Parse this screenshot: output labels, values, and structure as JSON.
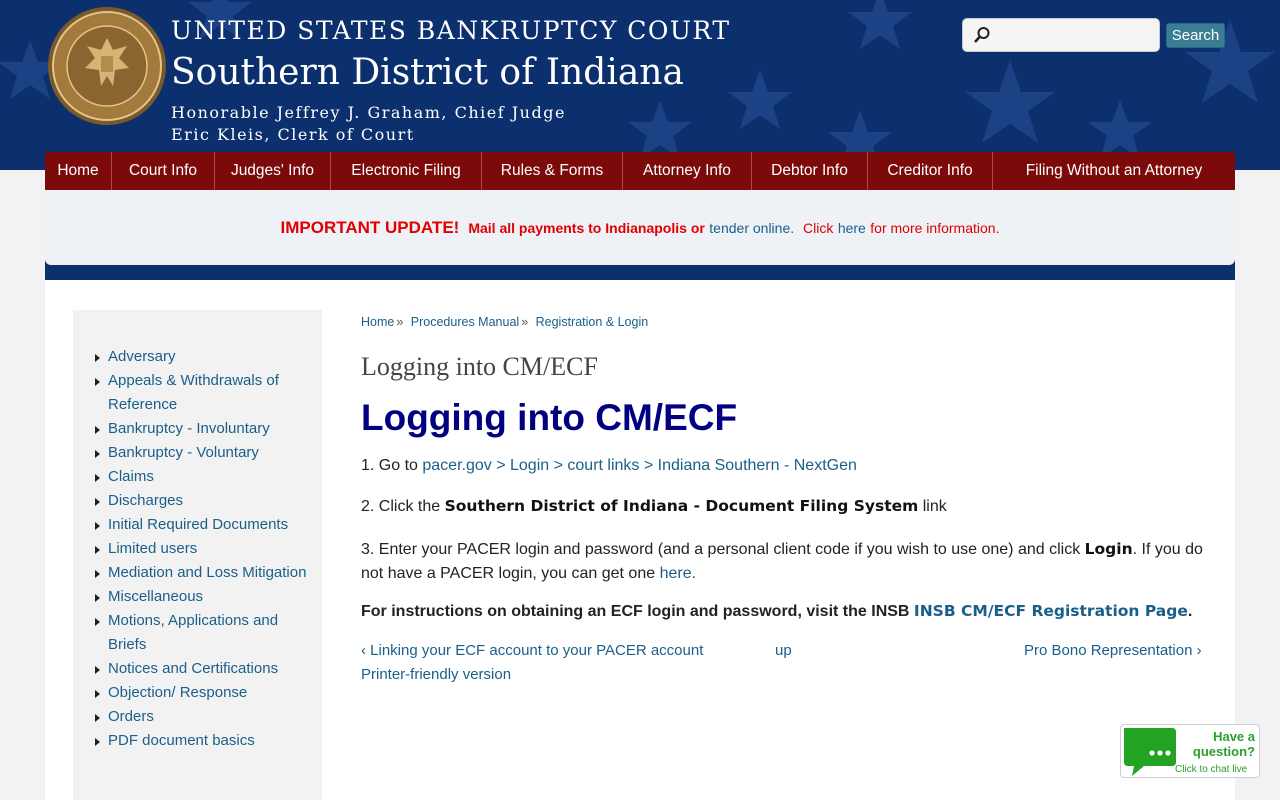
{
  "header": {
    "court_name": "UNITED STATES BANKRUPTCY COURT",
    "district": "Southern District of Indiana",
    "judge": "Honorable Jeffrey J. Graham, Chief Judge",
    "clerk": "Eric Kleis, Clerk of Court",
    "seal_icon": "court-seal-icon",
    "search": {
      "placeholder": "",
      "value": "",
      "button_label": "Search"
    }
  },
  "nav": {
    "items": [
      {
        "label": "Home"
      },
      {
        "label": "Court Info"
      },
      {
        "label": "Judges' Info"
      },
      {
        "label": "Electronic Filing"
      },
      {
        "label": "Rules & Forms"
      },
      {
        "label": "Attorney Info"
      },
      {
        "label": "Debtor Info"
      },
      {
        "label": "Creditor Info"
      },
      {
        "label": "Filing Without an Attorney"
      }
    ]
  },
  "alert": {
    "important": "IMPORTANT UPDATE!",
    "mail_text": "Mail all payments to Indianapolis or",
    "tender_link": "tender online.",
    "click_text": "Click",
    "here_link": "here",
    "more_text": "for more information."
  },
  "sidebar": {
    "items": [
      {
        "label": "Adversary"
      },
      {
        "label": "Appeals & Withdrawals of Reference"
      },
      {
        "label": "Bankruptcy - Involuntary"
      },
      {
        "label": "Bankruptcy - Voluntary"
      },
      {
        "label": "Claims"
      },
      {
        "label": "Discharges"
      },
      {
        "label": "Initial Required Documents"
      },
      {
        "label": "Limited users"
      },
      {
        "label": "Mediation and Loss Mitigation"
      },
      {
        "label": "Miscellaneous"
      },
      {
        "label": "Motions, Applications and Briefs"
      },
      {
        "label": "Notices and Certifications"
      },
      {
        "label": "Objection/ Response"
      },
      {
        "label": "Orders"
      },
      {
        "label": "PDF document basics"
      }
    ]
  },
  "breadcrumb": {
    "items": [
      "Home",
      "Procedures Manual",
      "Registration & Login"
    ],
    "separator": "»"
  },
  "main": {
    "page_title": "Logging into CM/ECF",
    "heading": "Logging into CM/ECF",
    "step1_prefix": "1. Go to ",
    "step1_link1": "pacer.gov",
    "step1_sep": " > ",
    "step1_link2": "Login",
    "step1_link3": "court links",
    "step1_link4": "Indiana Southern - NextGen",
    "step2_prefix": "2. Click the ",
    "step2_bold": "Southern District of Indiana - Document Filing System",
    "step2_suffix": " link",
    "step3_prefix": "3. Enter your PACER login and password (and a personal client code if you wish to use one) and click ",
    "step3_bold": "Login",
    "step3_middle": ". If you do not have a PACER login, you can get one ",
    "step3_link": "here.",
    "instructions_text": "For instructions on obtaining an ECF login and password, visit the INSB ",
    "instructions_link": "INSB CM/ECF Registration Page",
    "instructions_end": "."
  },
  "pager": {
    "prev": "‹ Linking your ECF account to your PACER account",
    "up": "up",
    "next": "Pro Bono Representation ›",
    "printer": "Printer-friendly version"
  },
  "chat": {
    "line1": "Have a question?",
    "line2": "Click to chat live",
    "icon": "chat-bubble-icon"
  },
  "colors": {
    "header_blue": "#0c2f6e",
    "nav_red": "#7d0a0a",
    "link_blue": "#1a5f8a",
    "heading_navy": "#000080",
    "alert_red": "#e00000",
    "chat_green": "#2ca02c"
  }
}
